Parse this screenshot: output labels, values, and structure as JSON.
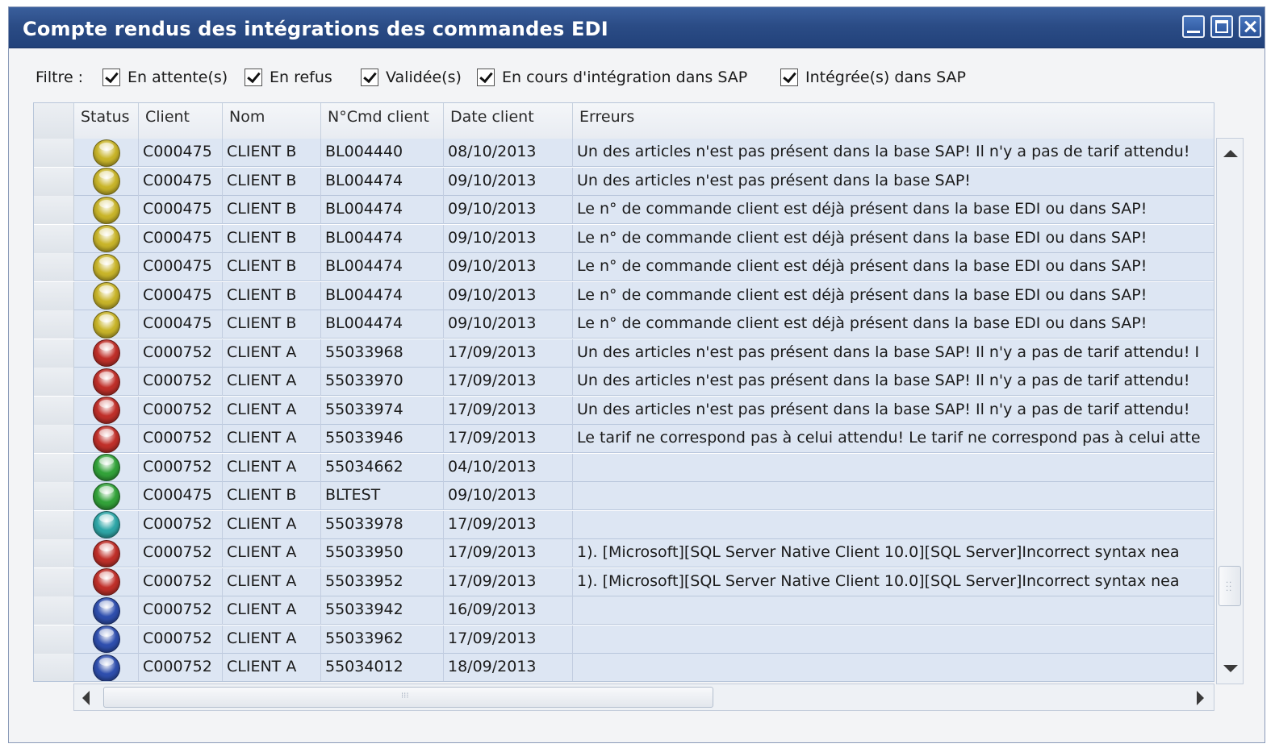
{
  "window": {
    "title": "Compte rendus des intégrations des commandes EDI",
    "controls": [
      "minimize-icon",
      "maximize-icon",
      "close-icon"
    ]
  },
  "filter": {
    "label": "Filtre :",
    "options": [
      {
        "label": "En attente(s)",
        "checked": true
      },
      {
        "label": "En refus",
        "checked": true
      },
      {
        "label": "Validée(s)",
        "checked": true
      },
      {
        "label": "En cours d'intégration dans SAP",
        "checked": true
      },
      {
        "label": "Intégrée(s) dans SAP",
        "checked": true
      }
    ]
  },
  "grid": {
    "columns": [
      "",
      "Status",
      "Client",
      "Nom",
      "N°Cmd client",
      "Date client",
      "Erreurs"
    ],
    "status_colors": {
      "yellow": "#c9b52a",
      "red": "#c0302a",
      "green": "#33a33a",
      "teal": "#2fa7a8",
      "blue": "#2f4fae"
    },
    "rows": [
      {
        "status": "yellow",
        "client": "C000475",
        "nom": "CLIENT B",
        "cmd": "BL004440",
        "date": "08/10/2013",
        "erreurs": "Un des articles n'est pas présent dans la base SAP!  Il n'y a pas de tarif attendu!"
      },
      {
        "status": "yellow",
        "client": "C000475",
        "nom": "CLIENT B",
        "cmd": "BL004474",
        "date": "09/10/2013",
        "erreurs": "Un des articles n'est pas présent dans la base SAP!"
      },
      {
        "status": "yellow",
        "client": "C000475",
        "nom": "CLIENT B",
        "cmd": "BL004474",
        "date": "09/10/2013",
        "erreurs": "Le n° de commande client est déjà présent dans la base EDI ou dans SAP!"
      },
      {
        "status": "yellow",
        "client": "C000475",
        "nom": "CLIENT B",
        "cmd": "BL004474",
        "date": "09/10/2013",
        "erreurs": "Le n° de commande client est déjà présent dans la base EDI ou dans SAP!"
      },
      {
        "status": "yellow",
        "client": "C000475",
        "nom": "CLIENT B",
        "cmd": "BL004474",
        "date": "09/10/2013",
        "erreurs": "Le n° de commande client est déjà présent dans la base EDI ou dans SAP!"
      },
      {
        "status": "yellow",
        "client": "C000475",
        "nom": "CLIENT B",
        "cmd": "BL004474",
        "date": "09/10/2013",
        "erreurs": "Le n° de commande client est déjà présent dans la base EDI ou dans SAP!"
      },
      {
        "status": "yellow",
        "client": "C000475",
        "nom": "CLIENT B",
        "cmd": "BL004474",
        "date": "09/10/2013",
        "erreurs": "Le n° de commande client est déjà présent dans la base EDI ou dans SAP!"
      },
      {
        "status": "red",
        "client": "C000752",
        "nom": "CLIENT A",
        "cmd": "55033968",
        "date": "17/09/2013",
        "erreurs": "Un des articles n'est pas présent dans la base SAP!  Il n'y a pas de tarif attendu!  I"
      },
      {
        "status": "red",
        "client": "C000752",
        "nom": "CLIENT A",
        "cmd": "55033970",
        "date": "17/09/2013",
        "erreurs": "Un des articles n'est pas présent dans la base SAP!  Il n'y a pas de tarif attendu!"
      },
      {
        "status": "red",
        "client": "C000752",
        "nom": "CLIENT A",
        "cmd": "55033974",
        "date": "17/09/2013",
        "erreurs": "Un des articles n'est pas présent dans la base SAP!  Il n'y a pas de tarif attendu!"
      },
      {
        "status": "red",
        "client": "C000752",
        "nom": "CLIENT A",
        "cmd": "55033946",
        "date": "17/09/2013",
        "erreurs": "Le tarif ne correspond pas à celui attendu!  Le tarif ne correspond pas à celui atte"
      },
      {
        "status": "green",
        "client": "C000752",
        "nom": "CLIENT A",
        "cmd": "55034662",
        "date": "04/10/2013",
        "erreurs": ""
      },
      {
        "status": "green",
        "client": "C000475",
        "nom": "CLIENT B",
        "cmd": "BLTEST",
        "date": "09/10/2013",
        "erreurs": ""
      },
      {
        "status": "teal",
        "client": "C000752",
        "nom": "CLIENT A",
        "cmd": "55033978",
        "date": "17/09/2013",
        "erreurs": ""
      },
      {
        "status": "red",
        "client": "C000752",
        "nom": "CLIENT A",
        "cmd": "55033950",
        "date": "17/09/2013",
        "erreurs": "1). [Microsoft][SQL Server Native Client 10.0][SQL Server]Incorrect syntax nea"
      },
      {
        "status": "red",
        "client": "C000752",
        "nom": "CLIENT A",
        "cmd": "55033952",
        "date": "17/09/2013",
        "erreurs": "1). [Microsoft][SQL Server Native Client 10.0][SQL Server]Incorrect syntax nea"
      },
      {
        "status": "blue",
        "client": "C000752",
        "nom": "CLIENT A",
        "cmd": "55033942",
        "date": "16/09/2013",
        "erreurs": ""
      },
      {
        "status": "blue",
        "client": "C000752",
        "nom": "CLIENT A",
        "cmd": "55033962",
        "date": "17/09/2013",
        "erreurs": ""
      },
      {
        "status": "blue",
        "client": "C000752",
        "nom": "CLIENT A",
        "cmd": "55034012",
        "date": "18/09/2013",
        "erreurs": ""
      }
    ]
  }
}
